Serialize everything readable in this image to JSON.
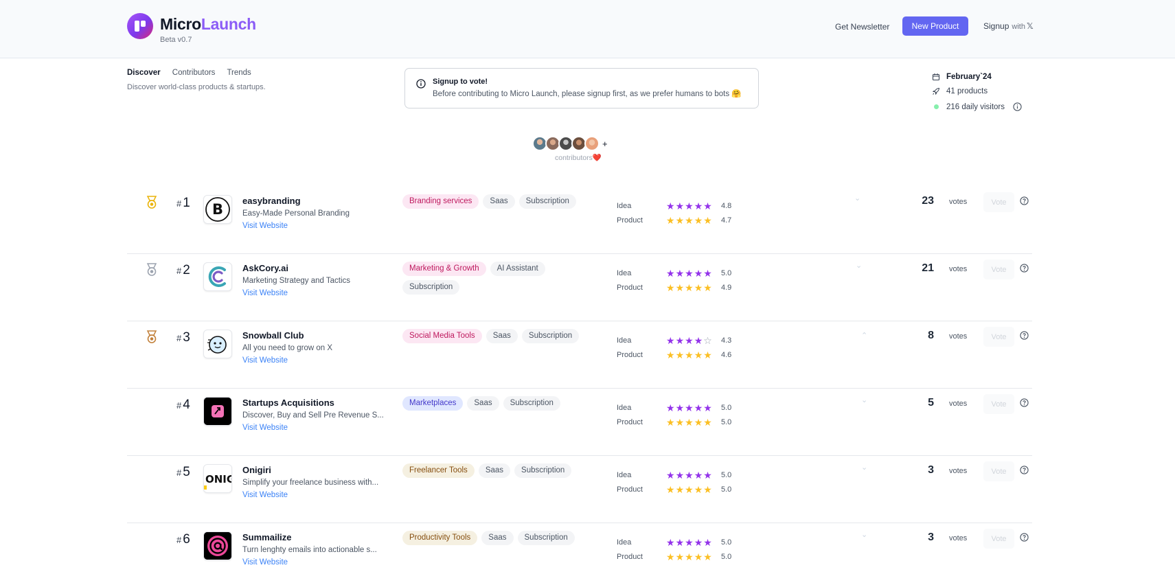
{
  "header": {
    "brand_part1": "Micro",
    "brand_part2": "Launch",
    "beta": "Beta v0.7",
    "newsletter": "Get Newsletter",
    "new_product": "New Product",
    "signup": "Signup",
    "signup_with": "with",
    "signup_x": "𝕏"
  },
  "nav": {
    "tabs": [
      {
        "label": "Discover",
        "active": true
      },
      {
        "label": "Contributors",
        "active": false
      },
      {
        "label": "Trends",
        "active": false
      }
    ],
    "description": "Discover world-class products & startups."
  },
  "notice": {
    "title": "Signup to vote!",
    "text": "Before contributing to Micro Launch, please signup first, as we prefer humans to bots 🤗"
  },
  "stats": {
    "month": "February`24",
    "products": "41 products",
    "visitors": "216 daily visitors"
  },
  "contributors": {
    "label": "contributors",
    "heart": "❤️",
    "plus": "+",
    "avatar_colors": [
      "#5b7a8c",
      "#8a6a5c",
      "#4b4b4b",
      "#6b4e3d",
      "#e8a07a"
    ]
  },
  "labels": {
    "idea": "Idea",
    "product": "Product",
    "visit": "Visit Website",
    "votes": "votes",
    "vote": "Vote",
    "hash": "#"
  },
  "products": [
    {
      "rank": "1",
      "name": "easybranding",
      "desc": "Easy-Made Personal Branding",
      "tags": [
        {
          "label": "Branding services",
          "style": "pink"
        },
        {
          "label": "Saas",
          "style": "gray"
        },
        {
          "label": "Subscription",
          "style": "gray"
        }
      ],
      "idea": "4.8",
      "product": "4.7",
      "votes": "23",
      "medal": "gold"
    },
    {
      "rank": "2",
      "name": "AskCory.ai",
      "desc": "Marketing Strategy and Tactics",
      "tags": [
        {
          "label": "Marketing & Growth",
          "style": "pink"
        },
        {
          "label": "AI Assistant",
          "style": "gray"
        },
        {
          "label": "Subscription",
          "style": "gray"
        }
      ],
      "idea": "5.0",
      "product": "4.9",
      "votes": "21",
      "medal": "silver"
    },
    {
      "rank": "3",
      "name": "Snowball Club",
      "desc": "All you need to grow on X",
      "tags": [
        {
          "label": "Social Media Tools",
          "style": "pink"
        },
        {
          "label": "Saas",
          "style": "gray"
        },
        {
          "label": "Subscription",
          "style": "gray"
        }
      ],
      "idea": "4.3",
      "product": "4.6",
      "votes": "8",
      "medal": "bronze"
    },
    {
      "rank": "4",
      "name": "Startups Acquisitions",
      "desc": "Discover, Buy and Sell Pre Revenue S...",
      "tags": [
        {
          "label": "Marketplaces",
          "style": "blue"
        },
        {
          "label": "Saas",
          "style": "gray"
        },
        {
          "label": "Subscription",
          "style": "gray"
        }
      ],
      "idea": "5.0",
      "product": "5.0",
      "votes": "5",
      "medal": ""
    },
    {
      "rank": "5",
      "name": "Onigiri",
      "desc": "Simplify your freelance business with...",
      "tags": [
        {
          "label": "Freelancer Tools",
          "style": "beige"
        },
        {
          "label": "Saas",
          "style": "gray"
        },
        {
          "label": "Subscription",
          "style": "gray"
        }
      ],
      "idea": "5.0",
      "product": "5.0",
      "votes": "3",
      "medal": ""
    },
    {
      "rank": "6",
      "name": "Summailize",
      "desc": "Turn lenghty emails into actionable s...",
      "tags": [
        {
          "label": "Productivity Tools",
          "style": "beige"
        },
        {
          "label": "Saas",
          "style": "gray"
        },
        {
          "label": "Subscription",
          "style": "gray"
        }
      ],
      "idea": "5.0",
      "product": "5.0",
      "votes": "3",
      "medal": ""
    }
  ],
  "thumb_texts": {
    "easybranding": "B",
    "onigiri": "ONIG"
  },
  "colors": {
    "accent": "#6366f1",
    "brand_purple": "#8b5cf6",
    "star_purple": "#9333ea",
    "star_yellow": "#fbbf24",
    "link": "#3b82f6"
  }
}
